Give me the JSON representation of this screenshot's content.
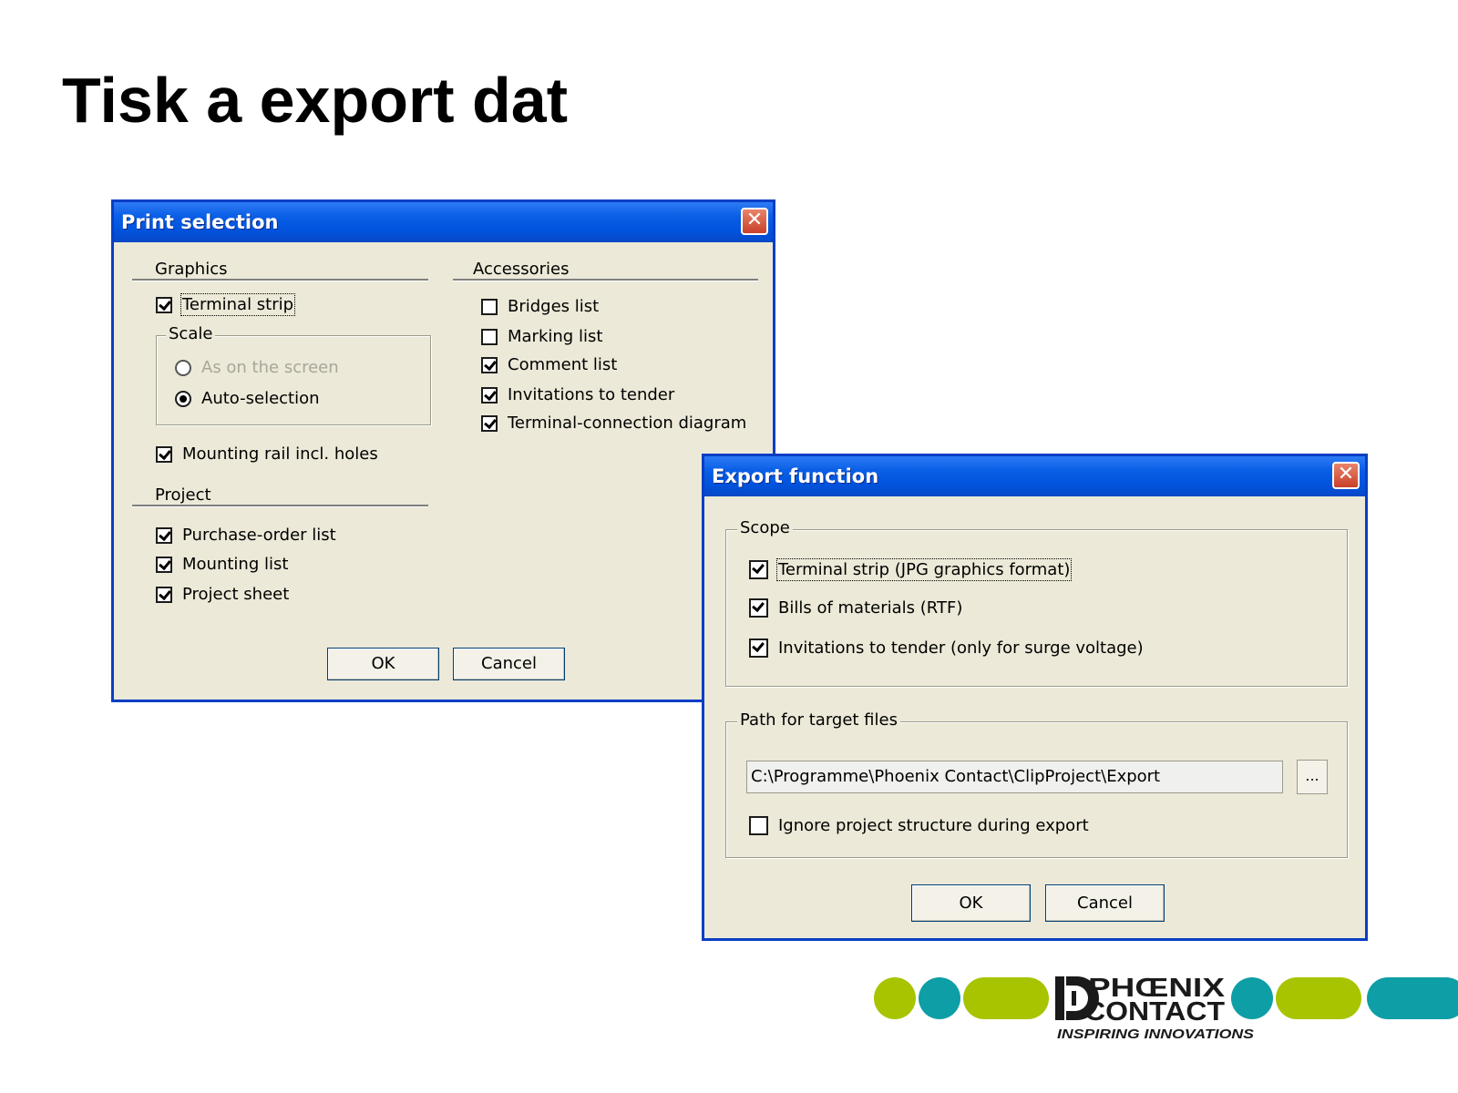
{
  "slide": {
    "title": "Tisk a export dat"
  },
  "print_dialog": {
    "title": "Print selection",
    "close_glyph": "✕",
    "graphics": {
      "heading": "Graphics",
      "terminal_strip": {
        "label": "Terminal strip",
        "checked": true
      },
      "scale": {
        "legend": "Scale",
        "options": [
          {
            "label": "As on the screen",
            "selected": false,
            "enabled": false
          },
          {
            "label": "Auto-selection",
            "selected": true,
            "enabled": true
          }
        ]
      },
      "mounting_rail": {
        "label": "Mounting rail incl. holes",
        "checked": true
      }
    },
    "project": {
      "heading": "Project",
      "items": [
        {
          "label": "Purchase-order list",
          "checked": true
        },
        {
          "label": "Mounting list",
          "checked": true
        },
        {
          "label": "Project sheet",
          "checked": true
        }
      ]
    },
    "accessories": {
      "heading": "Accessories",
      "items": [
        {
          "label": "Bridges list",
          "checked": false
        },
        {
          "label": "Marking list",
          "checked": false
        },
        {
          "label": "Comment list",
          "checked": true
        },
        {
          "label": "Invitations to tender",
          "checked": true
        },
        {
          "label": "Terminal-connection diagram",
          "checked": true
        }
      ]
    },
    "ok_label": "OK",
    "cancel_label": "Cancel"
  },
  "export_dialog": {
    "title": "Export function",
    "close_glyph": "✕",
    "scope": {
      "legend": "Scope",
      "items": [
        {
          "label": "Terminal strip (JPG graphics format)",
          "checked": true
        },
        {
          "label": "Bills of materials (RTF)",
          "checked": true
        },
        {
          "label": "Invitations to tender (only for surge voltage)",
          "checked": true
        }
      ]
    },
    "path": {
      "legend": "Path for target files",
      "value": "C:\\Programme\\Phoenix Contact\\ClipProject\\Export",
      "browse_label": "...",
      "ignore_structure": {
        "label": "Ignore project structure during export",
        "checked": false
      }
    },
    "ok_label": "OK",
    "cancel_label": "Cancel"
  },
  "logo": {
    "line1": "PHŒNIX",
    "line2": "CONTACT",
    "tagline": "INSPIRING INNOVATIONS",
    "colors": {
      "lime": "#a8c400",
      "teal": "#0e9ea5",
      "dark": "#1a1a1a"
    }
  }
}
